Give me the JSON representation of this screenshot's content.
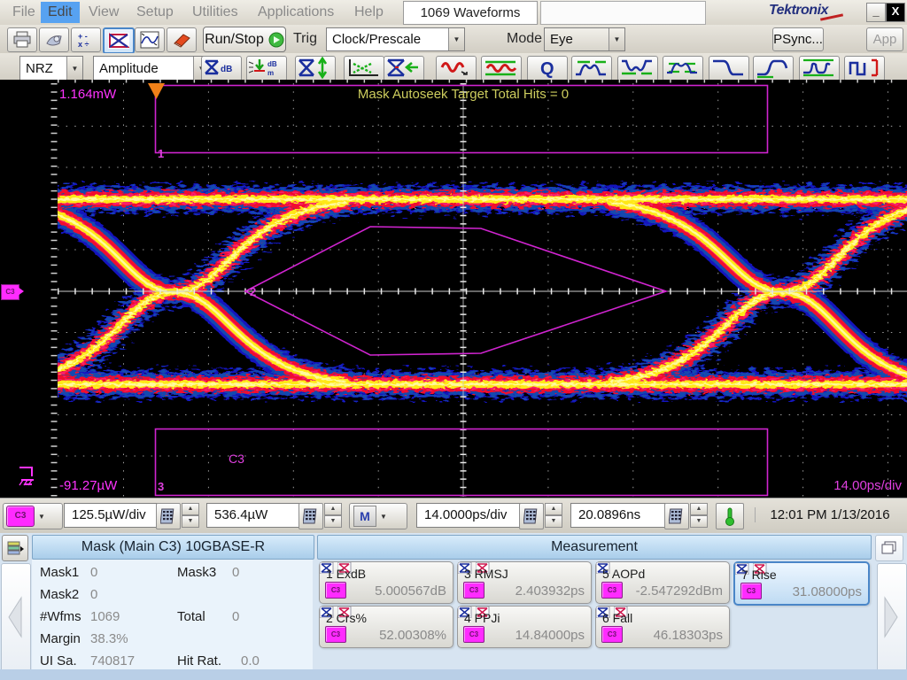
{
  "menu": {
    "items": [
      "File",
      "Edit",
      "View",
      "Setup",
      "Utilities",
      "Applications",
      "Help"
    ],
    "active_item": "Edit",
    "waveform_count": "1069 Waveforms",
    "brand": "Tektronix",
    "minimize": "_",
    "close": "X"
  },
  "toolbar": {
    "run_stop": "Run/Stop",
    "trig_label": "Trig",
    "trig_value": "Clock/Prescale",
    "mode_label": "Mode",
    "mode_value": "Eye",
    "psync": "PSync...",
    "app": "App"
  },
  "waveform_bar": {
    "format": "NRZ",
    "category": "Amplitude"
  },
  "plot": {
    "top_value": "1.164mW",
    "bottom_value": "-91.27µW",
    "time_per_div": "14.00ps/div",
    "autoseek": "Mask Autoseek Target Total Hits = 0",
    "mask1_label": "1",
    "mask2_label": "2",
    "mask3_label": "3",
    "trace_label": "C3",
    "source_marker": "C3",
    "colors": {
      "mask": "#d024d0",
      "text_magenta": "#ff33ff",
      "autoseek_yellow": "#cdcd5e",
      "eye_blue": "#1717c9",
      "eye_red": "#f1102e",
      "eye_yellow": "#ffe818"
    }
  },
  "scale_bar": {
    "channel": "C3",
    "vertical_scale": "125.5µW/div",
    "vertical_offset": "536.4µW",
    "timebase": "M",
    "horizontal_scale": "14.0000ps/div",
    "horizontal_position": "20.0896ns",
    "datetime": "12:01 PM 1/13/2016"
  },
  "mask_panel": {
    "title": "Mask (Main  C3) 10GBASE-R",
    "rows": [
      {
        "l1": "Mask1",
        "v1": "0",
        "l2": "Mask3",
        "v2": "0"
      },
      {
        "l1": "Mask2",
        "v1": "0"
      },
      {
        "l1": "#Wfms",
        "v1": "1069",
        "l2": "Total",
        "v2": "0"
      },
      {
        "l1": "Margin",
        "v1": "38.3%"
      },
      {
        "l1": "UI Sa.",
        "v1": "740817",
        "l2": "Hit Rat.",
        "v2": "0.0"
      }
    ]
  },
  "measurements": {
    "title": "Measurement",
    "source": "C3",
    "cells": [
      {
        "label": "1 ExdB",
        "value": "5.000567dB"
      },
      {
        "label": "3 RMSJ",
        "value": "2.403932ps"
      },
      {
        "label": "5 AOPd",
        "value": "-2.547292dBm"
      },
      {
        "label": "7 Rise",
        "value": "31.08000ps"
      },
      {
        "label": "2 Crs%",
        "value": "52.00308%"
      },
      {
        "label": "4 PPJi",
        "value": "14.84000ps"
      },
      {
        "label": "6 Fall",
        "value": "46.18303ps"
      }
    ]
  }
}
